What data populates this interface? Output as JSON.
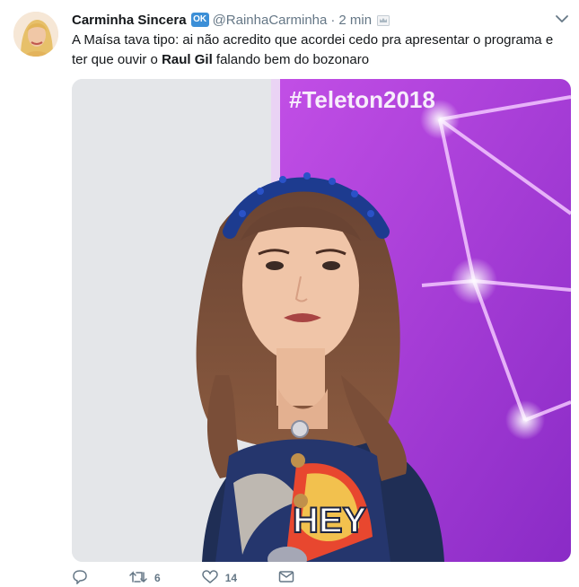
{
  "tweet": {
    "display_name": "Carminha Sincera",
    "badge_label": "OK",
    "handle": "@RainhaCarminha",
    "separator": "·",
    "timestamp": "2 min",
    "text_part1": "A Maísa tava tipo: ai não acredito que acordei cedo pra apresentar o programa e ter que ouvir o ",
    "text_bold": "Raul Gil",
    "text_part2": " falando bem do bozonaro",
    "image_caption": "#Teleton2018",
    "image_shirt_text": "HEY",
    "retweet_count": "6",
    "like_count": "14"
  },
  "colors": {
    "muted": "#657786",
    "badge": "#3c8fd7",
    "image_bg": "#b040d8"
  },
  "icons": [
    "avatar-photo",
    "ok-badge-icon",
    "crown-icon",
    "chevron-down-icon",
    "reply-icon",
    "retweet-icon",
    "like-icon",
    "message-icon"
  ]
}
